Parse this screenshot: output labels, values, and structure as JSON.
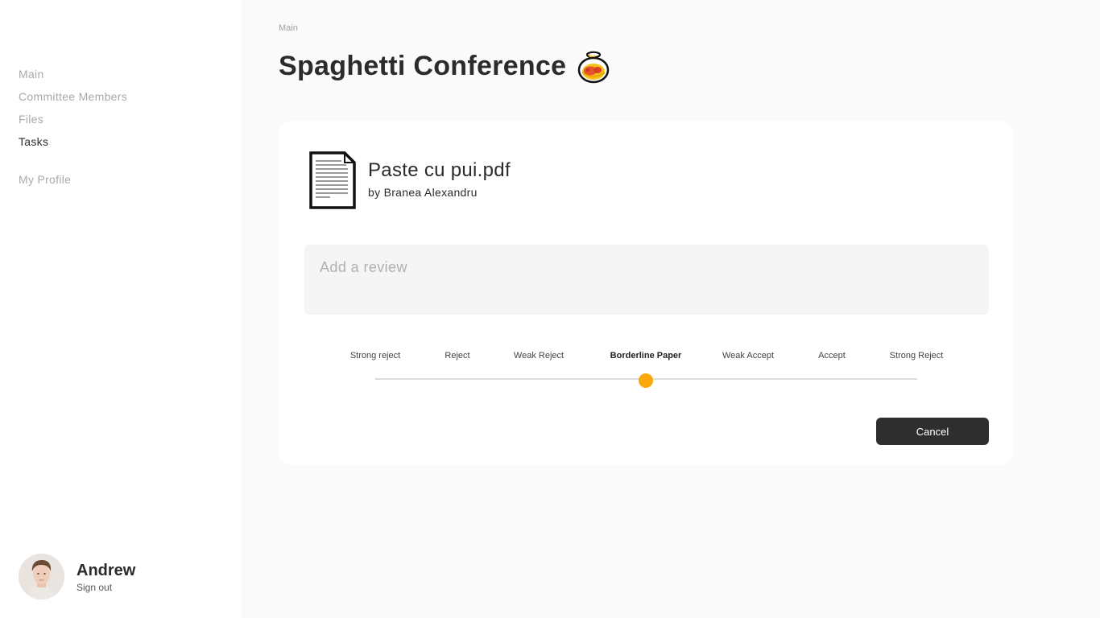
{
  "sidebar": {
    "items": [
      {
        "label": "Main",
        "active": false
      },
      {
        "label": "Committee Members",
        "active": false
      },
      {
        "label": "Files",
        "active": false
      },
      {
        "label": "Tasks",
        "active": true
      }
    ],
    "profile_label": "My Profile",
    "user": {
      "name": "Andrew",
      "signout_label": "Sign out",
      "avatar_icon": "user-photo"
    }
  },
  "header": {
    "breadcrumb": "Main",
    "title": "Spaghetti Conference",
    "title_icon": "spaghetti-bowl-icon"
  },
  "paper": {
    "file_name": "Paste cu pui.pdf",
    "author": "by Branea Alexandru",
    "file_icon": "document-icon"
  },
  "review": {
    "placeholder": "Add a review",
    "value": ""
  },
  "rating": {
    "options": [
      "Strong reject",
      "Reject",
      "Weak Reject",
      "Borderline Paper",
      "Weak Accept",
      "Accept",
      "Strong Reject"
    ],
    "selected_index": 3,
    "selected_label": "Borderline Paper",
    "accent_color": "#fca80d"
  },
  "actions": {
    "cancel_label": "Cancel"
  },
  "colors": {
    "primary_text": "#2b2b2b",
    "button_bg": "#2e2e2e",
    "accent": "#fca80d"
  }
}
